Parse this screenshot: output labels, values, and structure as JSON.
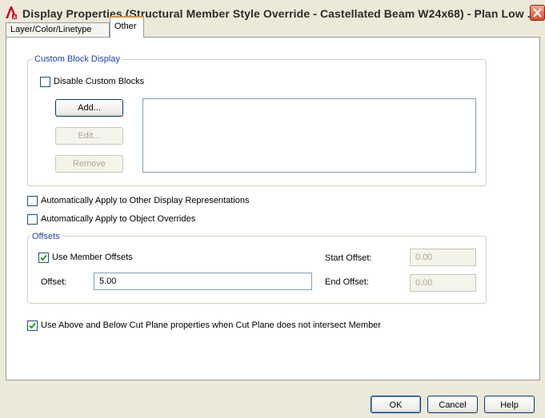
{
  "window": {
    "title": "Display Properties (Structural Member Style Override - Castellated Beam W24x68) - Plan Low ...",
    "app_icon": "autocad-a-icon",
    "close_icon": "close-x-icon"
  },
  "tabs": [
    {
      "label": "Layer/Color/Linetype",
      "active": false
    },
    {
      "label": "Other",
      "active": true
    }
  ],
  "custom_block_display": {
    "legend": "Custom Block Display",
    "disable_custom_blocks": {
      "label": "Disable Custom Blocks",
      "checked": false
    },
    "buttons": {
      "add": "Add...",
      "edit": "Edit...",
      "remove": "Remove"
    }
  },
  "options": {
    "apply_other_display_reps": {
      "label": "Automatically Apply to Other Display Representations",
      "checked": false
    },
    "apply_object_overrides": {
      "label": "Automatically Apply to Object Overrides",
      "checked": false
    }
  },
  "offsets": {
    "legend": "Offsets",
    "use_member_offsets": {
      "label": "Use Member Offsets",
      "checked": true
    },
    "offset_label": "Offset:",
    "offset_value": "5.00",
    "start_offset_label": "Start Offset:",
    "start_offset_value": "0.00",
    "end_offset_label": "End Offset:",
    "end_offset_value": "0.00"
  },
  "cut_plane": {
    "label": "Use Above and Below Cut Plane properties when Cut Plane does not intersect Member",
    "checked": true
  },
  "footer": {
    "ok": "OK",
    "cancel": "Cancel",
    "help": "Help"
  },
  "colors": {
    "accent_tab": "#e68b2c",
    "legend_text": "#1f3fa8",
    "check_mark": "#21a121",
    "dialog_bg": "#ece9d8"
  }
}
